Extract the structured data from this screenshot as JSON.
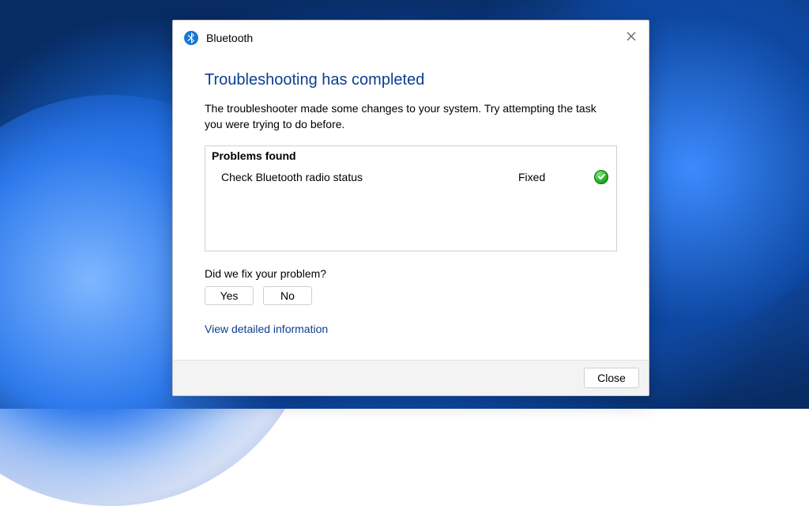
{
  "dialog": {
    "title": "Bluetooth",
    "heading": "Troubleshooting has completed",
    "description": "The troubleshooter made some changes to your system. Try attempting the task you were trying to do before.",
    "problems_header": "Problems found",
    "problems": [
      {
        "name": "Check Bluetooth radio status",
        "status": "Fixed"
      }
    ],
    "fix_question": "Did we fix your problem?",
    "yes_label": "Yes",
    "no_label": "No",
    "detail_link": "View detailed information",
    "close_label": "Close"
  }
}
